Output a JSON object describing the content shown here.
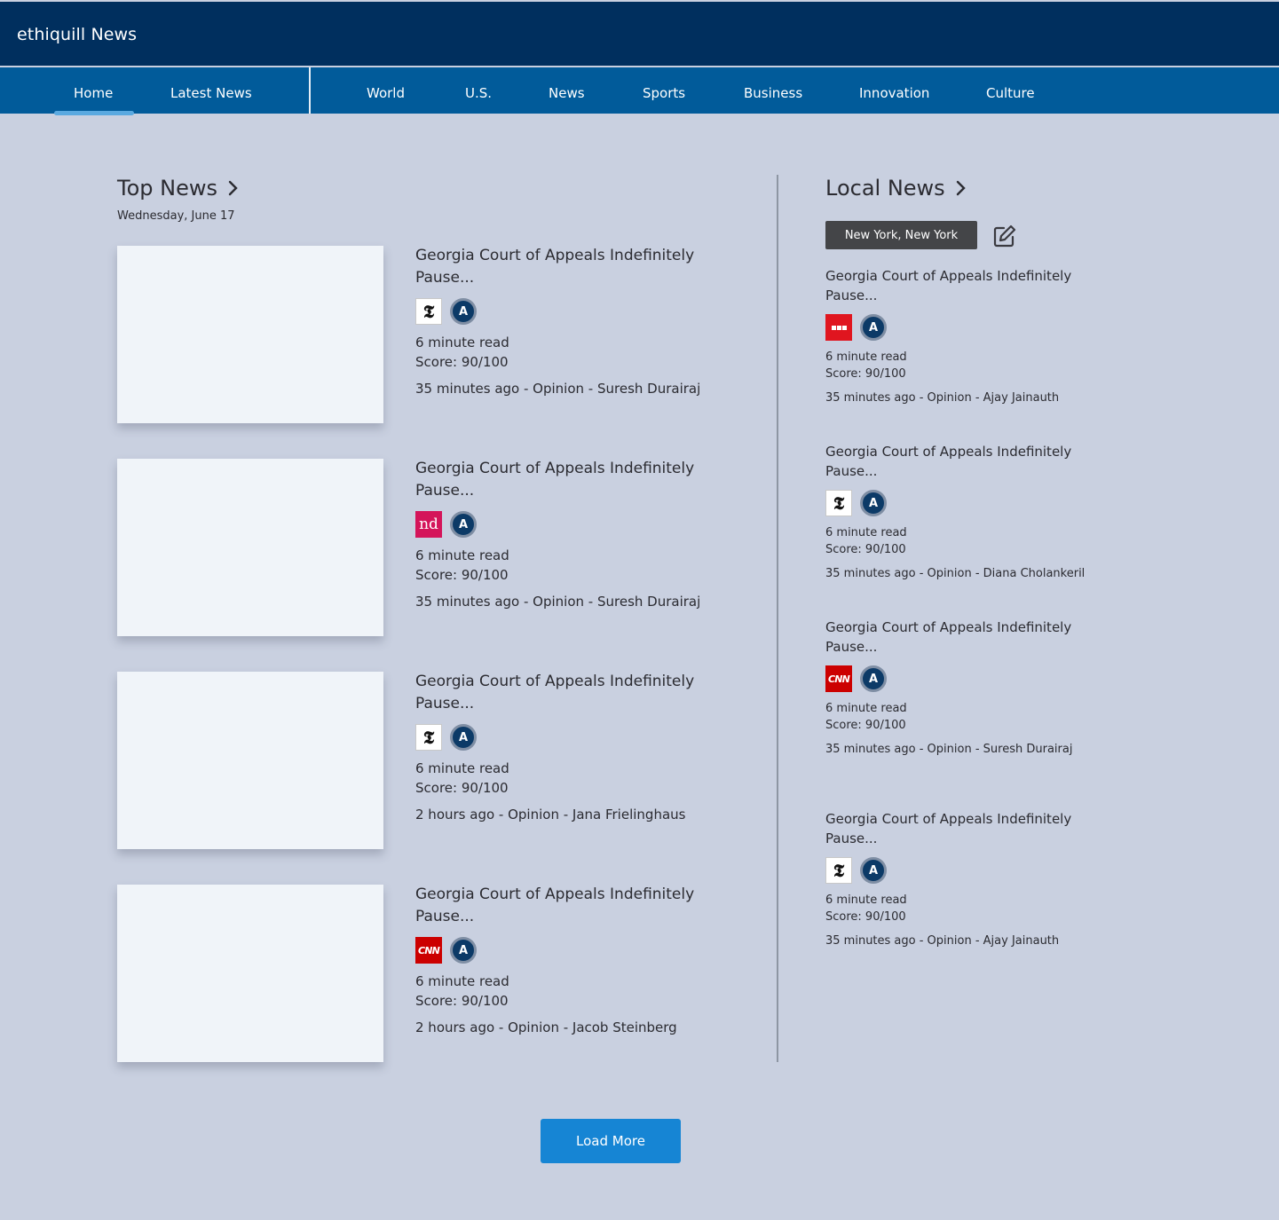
{
  "header": {
    "brand": "ethiquill News"
  },
  "nav": {
    "primary": [
      "Home",
      "Latest News"
    ],
    "sections": [
      "World",
      "U.S.",
      "News",
      "Sports",
      "Business",
      "Innovation",
      "Culture"
    ],
    "active": "Home"
  },
  "top_news": {
    "title": "Top News",
    "date": "Wednesday, June 17",
    "articles": [
      {
        "title": "Georgia Court of Appeals Indefinitely Pause...",
        "source_icon": "nyt-logo-icon",
        "read_time": "6 minute read",
        "score": "Score: 90/100",
        "byline": "35 minutes ago - Opinion - Suresh Durairaj"
      },
      {
        "title": "Georgia Court of Appeals Indefinitely Pause...",
        "source_icon": "nd-logo-icon",
        "read_time": "6 minute read",
        "score": "Score: 90/100",
        "byline": "35 minutes ago - Opinion - Suresh Durairaj"
      },
      {
        "title": "Georgia Court of Appeals Indefinitely Pause...",
        "source_icon": "nyt-logo-icon",
        "read_time": "6 minute read",
        "score": "Score: 90/100",
        "byline": "2 hours ago - Opinion - Jana Frielinghaus"
      },
      {
        "title": "Georgia Court of Appeals Indefinitely Pause...",
        "source_icon": "cnn-logo-icon",
        "read_time": "6 minute read",
        "score": "Score: 90/100",
        "byline": "2 hours ago - Opinion - Jacob Steinberg"
      }
    ]
  },
  "local_news": {
    "title": "Local News",
    "location": "New York, New York",
    "articles": [
      {
        "title": "Georgia Court of Appeals Indefinitely Pause...",
        "source_icon": "bbc-logo-icon",
        "read_time": "6 minute read",
        "score": "Score: 90/100",
        "byline": "35 minutes ago - Opinion - Ajay Jainauth"
      },
      {
        "title": "Georgia Court of Appeals Indefinitely Pause...",
        "source_icon": "nyt-logo-icon",
        "read_time": "6 minute read",
        "score": "Score: 90/100",
        "byline": "35 minutes ago - Opinion - Diana Cholankeril"
      },
      {
        "title": "Georgia Court of Appeals Indefinitely Pause...",
        "source_icon": "cnn-logo-icon",
        "read_time": "6 minute read",
        "score": "Score: 90/100",
        "byline": "35 minutes ago - Opinion - Suresh Durairaj"
      },
      {
        "title": "Georgia Court of Appeals Indefinitely Pause...",
        "source_icon": "nyt-logo-icon",
        "read_time": "6 minute read",
        "score": "Score: 90/100",
        "byline": "35 minutes ago - Opinion - Ajay Jainauth"
      }
    ]
  },
  "avatar_letter": "A",
  "logo_text": {
    "nyt": "𝕿",
    "nd": "nd",
    "cnn": "CNN"
  },
  "load_more_label": "Load More",
  "colors": {
    "header": "#002f5e",
    "nav": "#015b9a",
    "background": "#c9d0e0",
    "accent": "#1685d4",
    "nav_underline": "#5aa9e0"
  }
}
